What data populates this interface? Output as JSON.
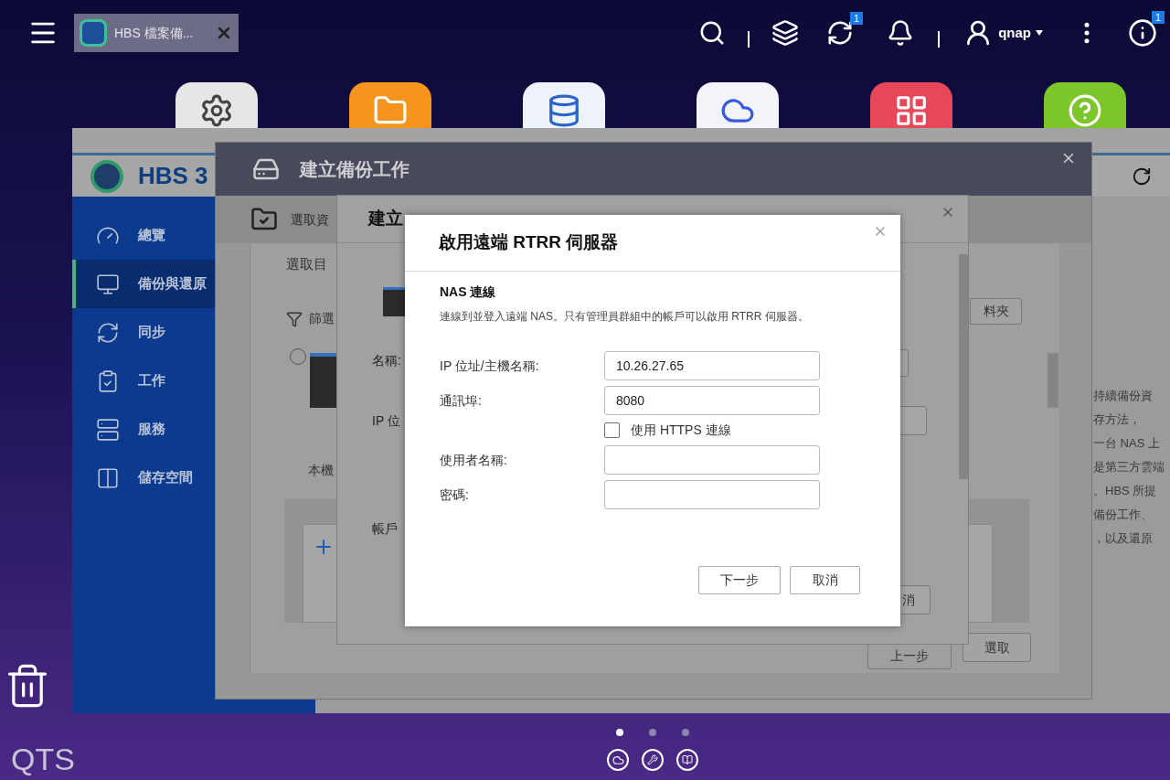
{
  "top_bar": {
    "open_app": {
      "label": "HBS 檔案備..."
    },
    "sync_badge": "1",
    "user_name": "qnap",
    "info_badge": "1"
  },
  "hbs_window": {
    "title": "HBS 3",
    "sidebar": [
      {
        "label": "總覽",
        "kind": "overview",
        "selected": false
      },
      {
        "label": "備份與還原",
        "kind": "backup",
        "selected": true
      },
      {
        "label": "同步",
        "kind": "sync",
        "selected": false
      },
      {
        "label": "工作",
        "kind": "jobs",
        "selected": false
      },
      {
        "label": "服務",
        "kind": "services",
        "selected": false
      },
      {
        "label": "儲存空間",
        "kind": "storage",
        "selected": false
      }
    ],
    "description_lines": [
      "持續備份資",
      "存方法，",
      "一台 NAS 上",
      "是第三方雲端",
      "。HBS 所提",
      "備份工作、",
      "，以及還原"
    ]
  },
  "backup_window": {
    "title": "建立備份工作",
    "step_label": "選取資",
    "heading": "選取目",
    "filter_label": "篩選",
    "device": {
      "label": "本機",
      "selected": false
    },
    "folder_button": "料夾",
    "back_button": "上一步",
    "select_button": "選取"
  },
  "create_window": {
    "title": "建立",
    "labels": [
      "名稱:",
      "IP 位",
      "帳戶"
    ],
    "cancel_button": "消"
  },
  "dialog": {
    "title": "啟用遠端 RTRR 伺服器",
    "section_title": "NAS 連線",
    "description": "連線到並登入遠端 NAS。只有管理員群組中的帳戶可以啟用 RTRR 伺服器。",
    "rows": [
      {
        "kind": "input",
        "label": "IP 位址/主機名稱:",
        "value": "10.26.27.65"
      },
      {
        "kind": "input",
        "label": "通訊埠:",
        "value": "8080"
      },
      {
        "kind": "checkbox",
        "label": "使用 HTTPS 連線",
        "checked": false
      },
      {
        "kind": "input",
        "label": "使用者名稱:"
      },
      {
        "kind": "input",
        "label": "密碼:"
      }
    ],
    "buttons": [
      "下一步",
      "取消"
    ]
  },
  "desktop": {
    "pages": [
      {
        "selected": true
      },
      {
        "selected": false
      },
      {
        "selected": false
      }
    ],
    "brand": "QTS"
  }
}
